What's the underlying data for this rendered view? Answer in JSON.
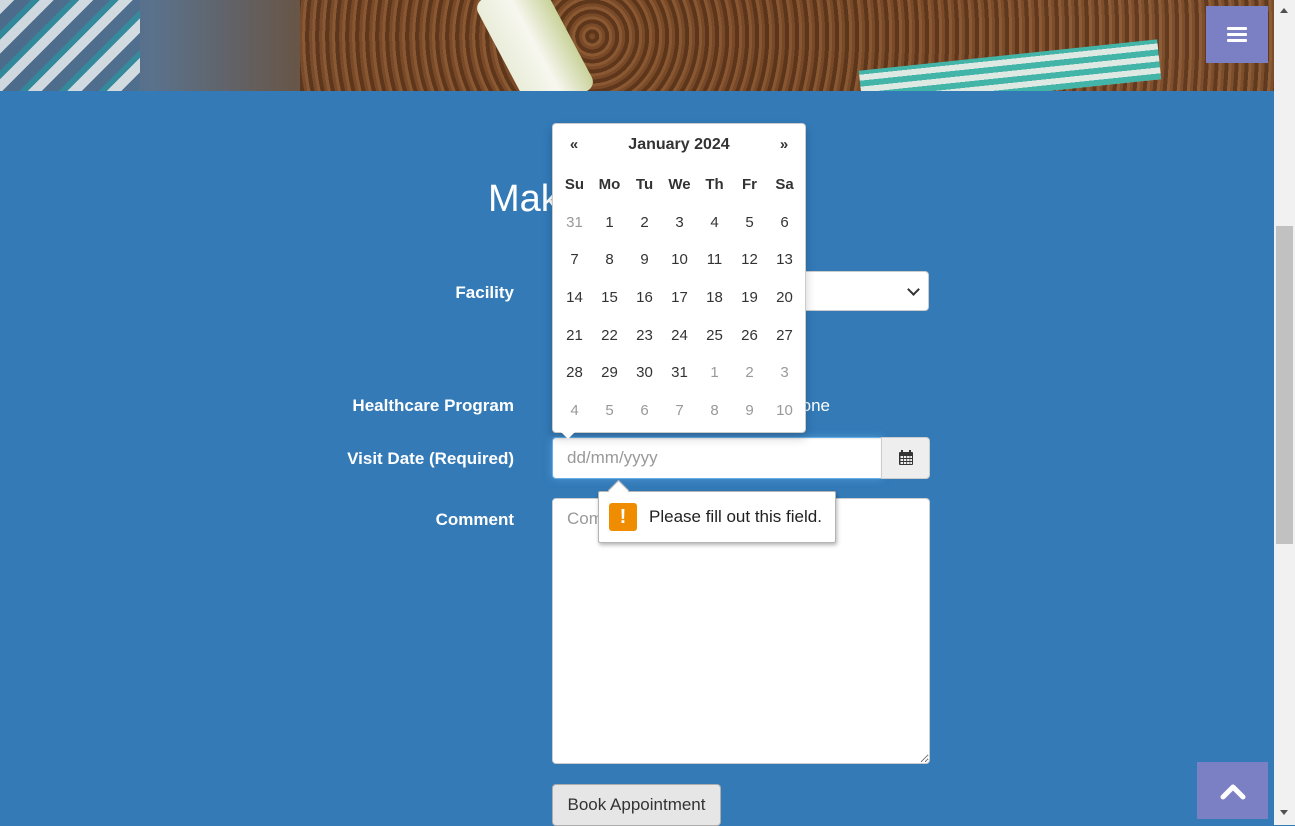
{
  "page": {
    "title": "Make Appointment",
    "menu_icon": "bars-icon",
    "to_top_icon": "chevron-up-icon"
  },
  "form": {
    "facility_label": "Facility",
    "facility_value": "",
    "program_label": "Healthcare Program",
    "program_visible_option": "None",
    "visit_date_label": "Visit Date (Required)",
    "visit_date_placeholder": "dd/mm/yyyy",
    "comment_label": "Comment",
    "comment_placeholder": "Comment",
    "submit_label": "Book Appointment"
  },
  "datepicker": {
    "month_title": "January 2024",
    "prev": "«",
    "next": "»",
    "weekdays": [
      "Su",
      "Mo",
      "Tu",
      "We",
      "Th",
      "Fr",
      "Sa"
    ],
    "weeks": [
      [
        {
          "d": "31",
          "old": true
        },
        {
          "d": "1"
        },
        {
          "d": "2"
        },
        {
          "d": "3"
        },
        {
          "d": "4"
        },
        {
          "d": "5"
        },
        {
          "d": "6"
        }
      ],
      [
        {
          "d": "7"
        },
        {
          "d": "8"
        },
        {
          "d": "9"
        },
        {
          "d": "10"
        },
        {
          "d": "11"
        },
        {
          "d": "12"
        },
        {
          "d": "13"
        }
      ],
      [
        {
          "d": "14"
        },
        {
          "d": "15"
        },
        {
          "d": "16"
        },
        {
          "d": "17"
        },
        {
          "d": "18"
        },
        {
          "d": "19"
        },
        {
          "d": "20"
        }
      ],
      [
        {
          "d": "21"
        },
        {
          "d": "22"
        },
        {
          "d": "23"
        },
        {
          "d": "24"
        },
        {
          "d": "25"
        },
        {
          "d": "26"
        },
        {
          "d": "27"
        }
      ],
      [
        {
          "d": "28"
        },
        {
          "d": "29"
        },
        {
          "d": "30"
        },
        {
          "d": "31"
        },
        {
          "d": "1",
          "old": true
        },
        {
          "d": "2",
          "old": true
        },
        {
          "d": "3",
          "old": true
        }
      ],
      [
        {
          "d": "4",
          "old": true
        },
        {
          "d": "5",
          "old": true
        },
        {
          "d": "6",
          "old": true
        },
        {
          "d": "7",
          "old": true
        },
        {
          "d": "8",
          "old": true
        },
        {
          "d": "9",
          "old": true
        },
        {
          "d": "10",
          "old": true
        }
      ]
    ]
  },
  "validation": {
    "message": "Please fill out this field.",
    "icon": "!"
  },
  "colors": {
    "background": "#337ab7",
    "menu_button": "#7b7fc4",
    "warning": "#f08c00"
  }
}
